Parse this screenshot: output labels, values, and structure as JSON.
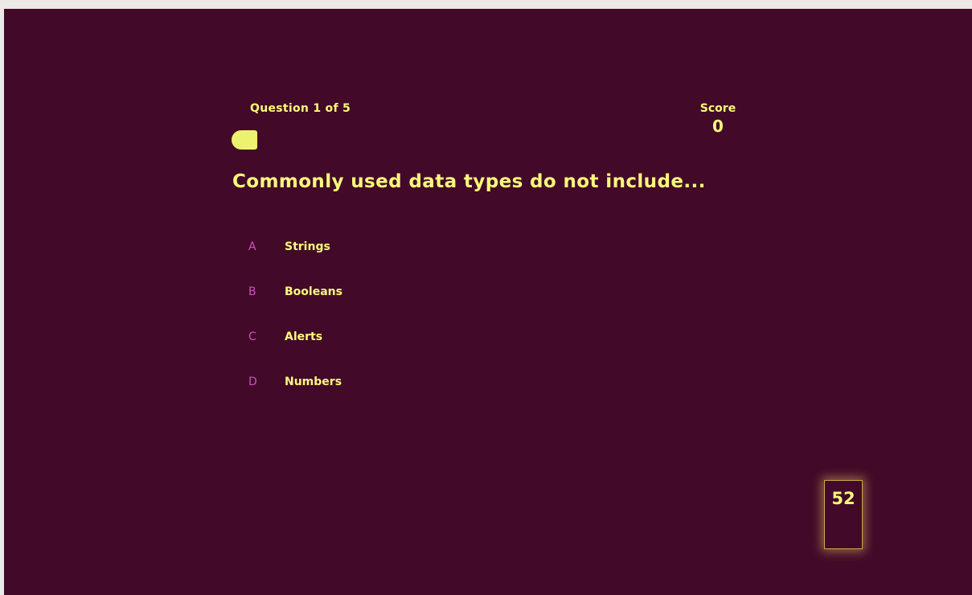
{
  "hud": {
    "progress_text": "Question 1 of 5",
    "progress_fraction": 0.2,
    "score_label": "Score",
    "score_value": "0"
  },
  "question": {
    "text": "Commonly used data types do not include..."
  },
  "options": [
    {
      "prefix": "A",
      "text": "Strings"
    },
    {
      "prefix": "B",
      "text": "Booleans"
    },
    {
      "prefix": "C",
      "text": "Alerts"
    },
    {
      "prefix": "D",
      "text": "Numbers"
    }
  ],
  "timer": {
    "value": "52"
  },
  "colors": {
    "background": "#420a28",
    "text": "#fafa7a",
    "prefix": "#d24fc7",
    "progress_fill": "#ecf26e"
  }
}
